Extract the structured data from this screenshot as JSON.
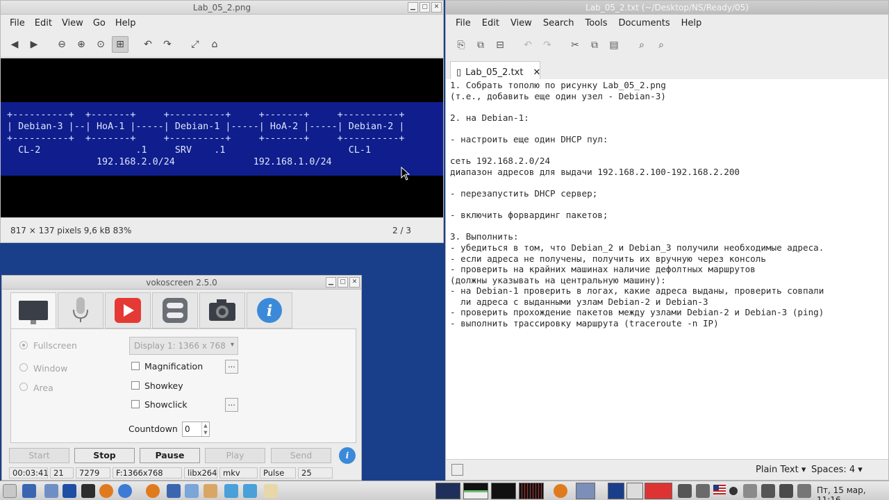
{
  "viewer": {
    "title": "Lab_05_2.png",
    "menu": [
      "File",
      "Edit",
      "View",
      "Go",
      "Help"
    ],
    "image_lines": [
      "+----------+  +-------+     +----------+     +-------+     +----------+",
      "| Debian-3 |--| HoA-1 |-----| Debian-1 |-----| HoA-2 |-----| Debian-2 |",
      "+----------+  +-------+     +----------+     +-------+     +----------+",
      "  CL-2                 .1     SRV    .1                      CL-1",
      "                192.168.2.0/24              192.168.1.0/24"
    ],
    "status_info": "817 × 137 pixels  9,6 kB   83%",
    "page_counter": "2 / 3"
  },
  "editor": {
    "title": "Lab_05_2.txt (~/Desktop/NS/Ready/05)",
    "menu": [
      "File",
      "Edit",
      "View",
      "Search",
      "Tools",
      "Documents",
      "Help"
    ],
    "tab_label": "Lab_05_2.txt",
    "content": "1. Собрать тополю по рисунку Lab_05_2.png\n(т.е., добавить еще один узел - Debian-3)\n\n2. на Debian-1:\n\n- настроить еще один DHCP пул:\n\nсеть 192.168.2.0/24\nдиапазон адресов для выдачи 192.168.2.100-192.168.2.200\n\n- перезапустить DHCP сервер;\n\n- включить форвардинг пакетов;\n\n3. Выполнить:\n- убедиться в том, что Debian_2 и Debian_3 получили необходимые адреса.\n- если адреса не получены, получить их вручную через консоль\n- проверить на крайних машинах наличие дефолтных маршрутов\n(должны указывать на центральную машину):\n- на Debian-1 проверить в логах, какие адреса выданы, проверить совпали\n  ли адреса с выданными узлам Debian-2 и Debian-3\n- проверить прохождение пакетов между узлами Debian-2 и Debian-3 (ping)\n- выполнить трассировку маршрута (traceroute -n IP)",
    "syntax": "Plain Text",
    "spaces": "Spaces: 4"
  },
  "voko": {
    "title": "vokoscreen 2.5.0",
    "fullscreen": "Fullscreen",
    "window": "Window",
    "area": "Area",
    "display": "Display 1:  1366 x 768",
    "magnification": "Magnification",
    "showkey": "Showkey",
    "showclick": "Showclick",
    "countdown_label": "Countdown",
    "countdown_value": "0",
    "btn_start": "Start",
    "btn_stop": "Stop",
    "btn_pause": "Pause",
    "btn_play": "Play",
    "btn_send": "Send",
    "status": [
      "00:03:41",
      "21",
      "7279",
      "F:1366x768",
      "libx264",
      "mkv",
      "Pulse",
      "25"
    ]
  },
  "taskbar": {
    "clock": "Пт, 15 мар, 11:16"
  },
  "colors": {
    "desktop": "#1a3f8a",
    "image_blue": "#0f1e8c",
    "voko_red": "#e53935",
    "voko_info": "#3b8ad9"
  }
}
